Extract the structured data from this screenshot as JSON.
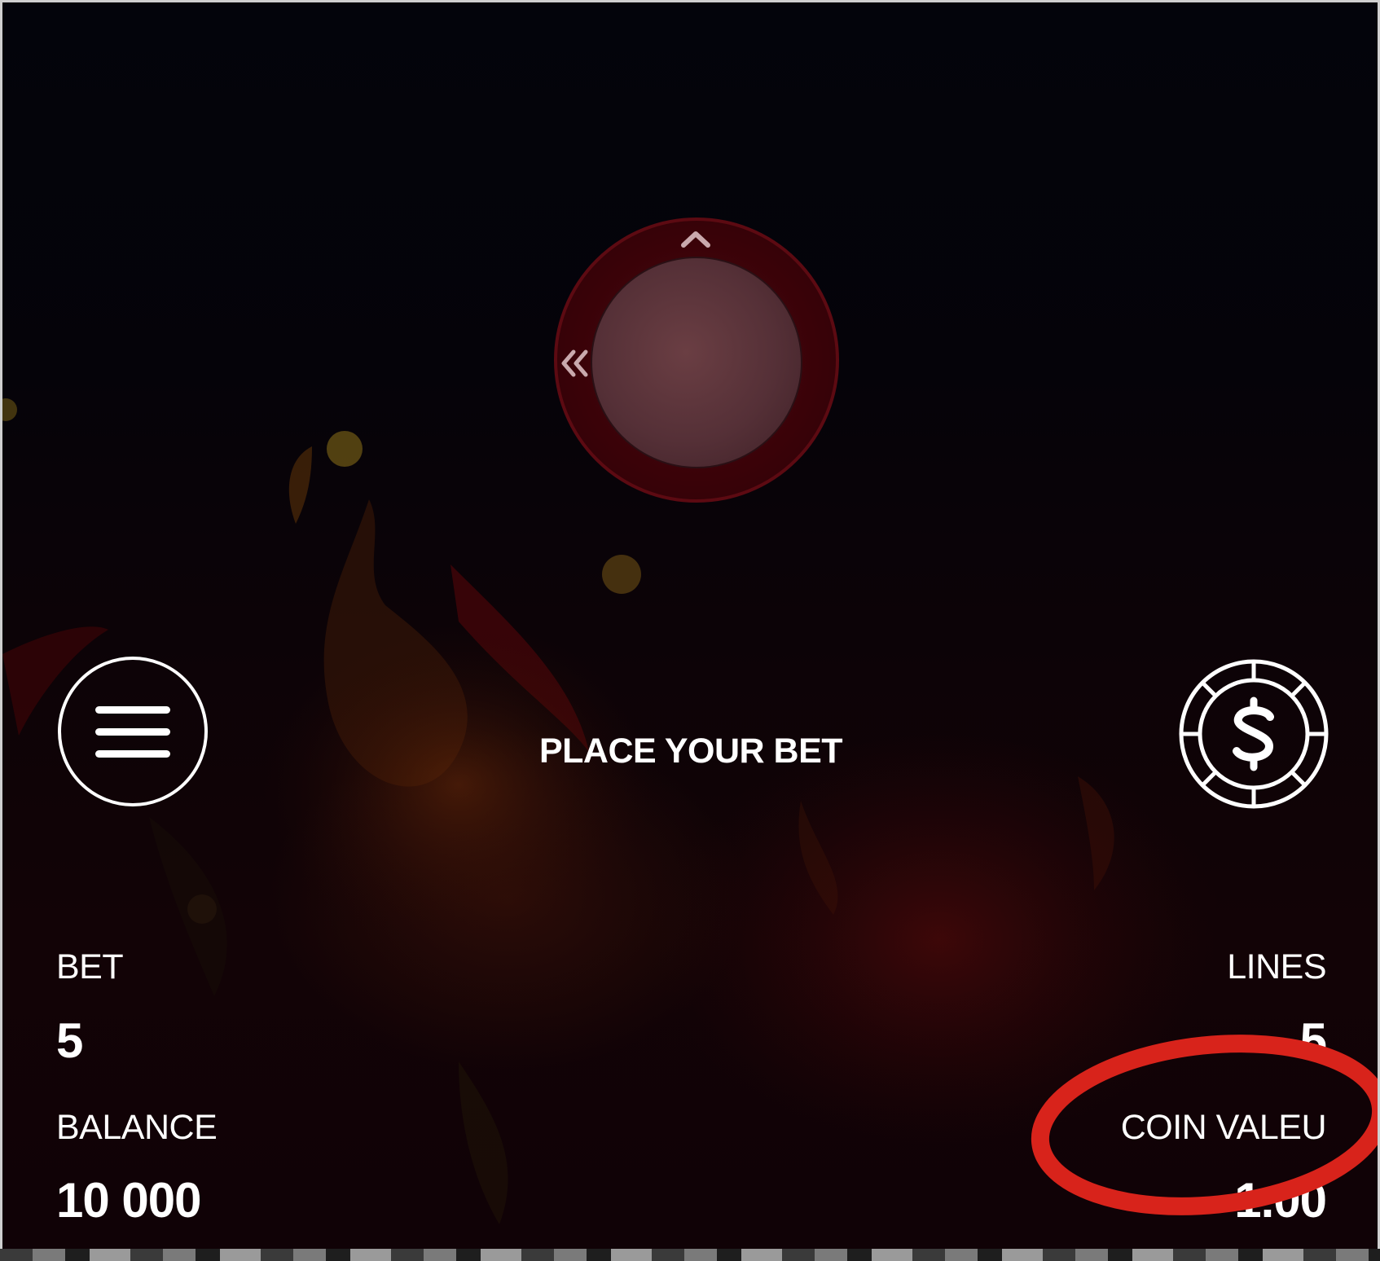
{
  "joystick": {
    "up_icon": "chevron-up-icon",
    "left_icon": "double-chevron-left-icon"
  },
  "menu_button": {
    "icon": "hamburger-menu-icon"
  },
  "bet_button": {
    "icon": "dollar-chip-icon"
  },
  "status": {
    "message": "PLACE YOUR BET"
  },
  "stats": {
    "bet_label": "BET",
    "bet_value": "5",
    "lines_label": "LINES",
    "lines_value": "5",
    "balance_label": "BALANCE",
    "balance_value": "10 000",
    "coin_value_label": "COIN VALEU",
    "coin_value_value": "1.00"
  },
  "colors": {
    "background": "#05040a",
    "ring": "#3a0208",
    "knob": "#553037",
    "text": "#ffffff",
    "annotation": "#d8231b"
  }
}
